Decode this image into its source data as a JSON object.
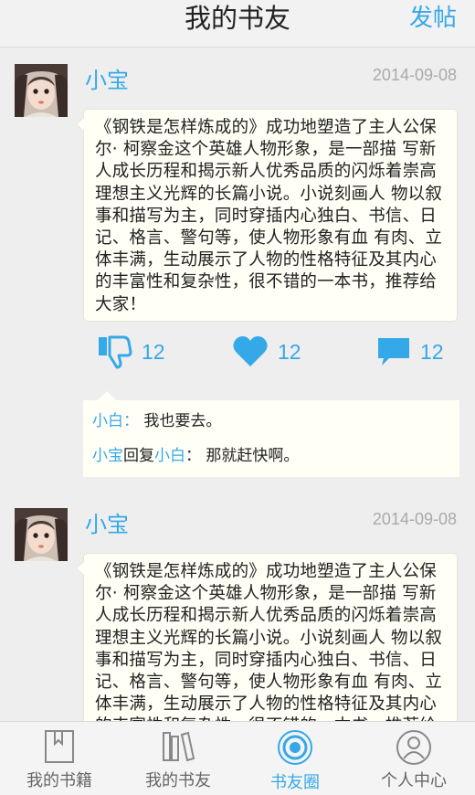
{
  "header": {
    "title": "我的书友",
    "post_label": "发帖"
  },
  "posts": [
    {
      "author": "小宝",
      "date": "2014-09-08",
      "content": "《钢铁是怎样炼成的》成功地塑造了主人公保尔· 柯察金这个英雄人物形象，是一部描 写新人成长历程和揭示新人优秀品质的闪烁着崇高理想主义光辉的长篇小说。小说刻画人 物以叙事和描写为主，同时穿插内心独白、书信、日记、格言、警句等，使人物形象有血 有肉、立体丰满，生动展示了人物的性格特征及其内心的丰富性和复杂性，很不错的一本书，推荐给大家！",
      "dislike_count": "12",
      "like_count": "12",
      "comment_count": "12",
      "comments": [
        {
          "name": "小白",
          "sep": "：",
          "text": "我也要去。"
        },
        {
          "name": "小宝",
          "mid": "回复",
          "reply_to": "小白",
          "sep": "：",
          "text": "那就赶快啊。"
        }
      ]
    },
    {
      "author": "小宝",
      "date": "2014-09-08",
      "content": "《钢铁是怎样炼成的》成功地塑造了主人公保尔· 柯察金这个英雄人物形象，是一部描 写新人成长历程和揭示新人优秀品质的闪烁着崇高理想主义光辉的长篇小说。小说刻画人 物以叙事和描写为主，同时穿插内心独白、书信、日记、格言、警句等，使人物形象有血 有肉、立体丰满，生动展示了人物的性格特征及其内心的丰富性和复杂性，很不错的一本书，推荐给大家！"
    }
  ],
  "tabs": [
    {
      "label": "我的书籍",
      "icon": "book-icon"
    },
    {
      "label": "我的书友",
      "icon": "bookshelf-icon"
    },
    {
      "label": "书友圈",
      "icon": "circle-target-icon",
      "active": true
    },
    {
      "label": "个人中心",
      "icon": "user-icon"
    }
  ],
  "colors": {
    "accent": "#35a8e8",
    "bubble": "#fffff6",
    "date": "#aaaaaa"
  }
}
